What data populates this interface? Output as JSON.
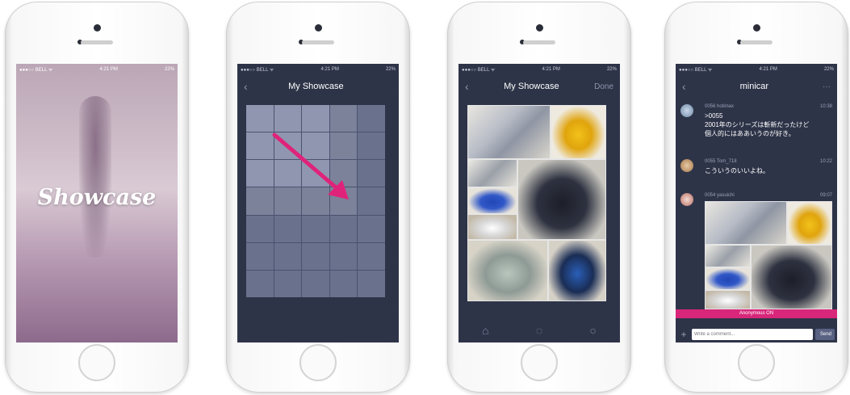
{
  "phone1": {
    "status": {
      "carrier": "●●●○○ BELL ᯤ",
      "time": "4:21 PM",
      "battery": "22%"
    },
    "logo": "Showcase"
  },
  "phone2": {
    "status": {
      "carrier": "●●●○○ BELL ᯤ",
      "time": "4:21 PM",
      "battery": "22%"
    },
    "nav": {
      "back": "‹",
      "title": "My Showcase"
    }
  },
  "phone3": {
    "status": {
      "carrier": "●●●○○ BELL ᯤ",
      "time": "4:21 PM",
      "battery": "22%"
    },
    "nav": {
      "back": "‹",
      "title": "My Showcase",
      "done": "Done"
    },
    "tabs": [
      "⌂",
      "◌",
      "○"
    ]
  },
  "phone4": {
    "status": {
      "carrier": "●●●○○ BELL ᯤ",
      "time": "4:21 PM",
      "battery": "22%"
    },
    "nav": {
      "back": "‹",
      "title": "minicar",
      "more": "···"
    },
    "messages": [
      {
        "meta": "0056 hotimax",
        "time": "10:38",
        "text": ">0055\n2001年のシリーズは斬新だったけど\n個人的にはああいうのが好き。"
      },
      {
        "meta": "0055 Tom_718",
        "time": "10:22",
        "text": "こういうのいいよね。"
      },
      {
        "meta": "0054 yasuichi",
        "time": "09:07",
        "text": ""
      }
    ],
    "banner": "Anonymous ON",
    "input": {
      "placeholder": "Write a comment...",
      "send": "Send",
      "plus": "+"
    }
  }
}
